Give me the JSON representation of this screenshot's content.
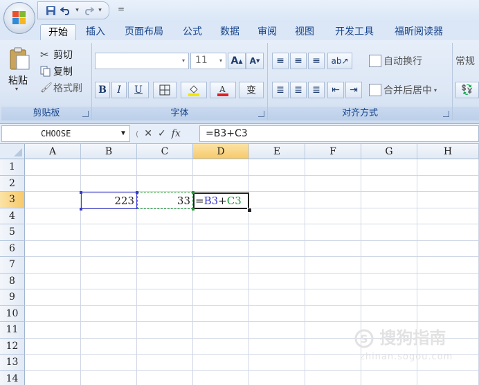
{
  "window": {
    "quick_access_custom": "="
  },
  "icons": {
    "save": "save-icon",
    "undo": "undo-icon",
    "redo": "redo-icon"
  },
  "tabs": [
    "开始",
    "插入",
    "页面布局",
    "公式",
    "数据",
    "审阅",
    "视图",
    "开发工具",
    "福昕阅读器"
  ],
  "active_tab": "开始",
  "ribbon": {
    "clipboard": {
      "label": "剪贴板",
      "paste": "粘贴",
      "cut": "剪切",
      "copy": "复制",
      "format_painter": "格式刷"
    },
    "font": {
      "label": "字体",
      "font_name": "",
      "font_size": "11",
      "grow": "A",
      "shrink": "A",
      "bold": "B",
      "italic": "I",
      "underline": "U",
      "phonetic": "变"
    },
    "alignment": {
      "label": "对齐方式",
      "wrap": "自动换行",
      "merge": "合并后居中"
    },
    "number": {
      "format": "常规"
    }
  },
  "formula_bar": {
    "name_box": "CHOOSE",
    "fx": "fx",
    "cancel": "✕",
    "enter": "✓",
    "formula": "=B3+C3"
  },
  "grid": {
    "columns": [
      "A",
      "B",
      "C",
      "D",
      "E",
      "F",
      "G",
      "H"
    ],
    "selected_column": "D",
    "rows": [
      "1",
      "2",
      "3",
      "4",
      "5",
      "6",
      "7",
      "8",
      "9",
      "10",
      "11",
      "12",
      "13",
      "14"
    ],
    "selected_row": "3",
    "cells": {
      "B3": "223",
      "C3": "33",
      "D3_prefix": "=",
      "D3_ref1": "B3",
      "D3_op": "+",
      "D3_ref2": "C3"
    },
    "colors": {
      "ref1": "#3333cc",
      "ref2": "#1f9a3a",
      "header_selected": "#f7c96a"
    }
  },
  "watermark": {
    "text": "搜狗指南",
    "url": "zhinan.sogou.com"
  }
}
